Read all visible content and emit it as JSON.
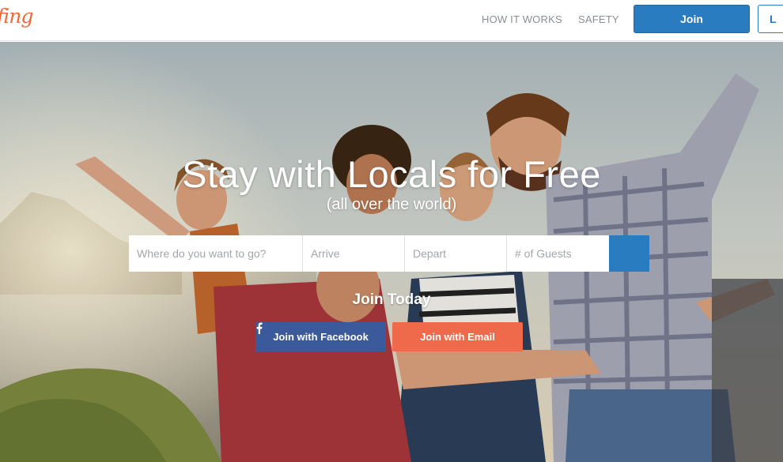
{
  "header": {
    "logo_text": "fing",
    "nav": {
      "how_it_works": "HOW IT WORKS",
      "safety": "SAFETY"
    },
    "join_label": "Join",
    "login_label": "L"
  },
  "hero": {
    "headline": "Stay with Locals for Free",
    "subheadline": "(all over the world)",
    "search": {
      "destination_placeholder": "Where do you want to go?",
      "arrive_placeholder": "Arrive",
      "depart_placeholder": "Depart",
      "guests_placeholder": "# of Guests",
      "search_icon": "search-icon"
    },
    "join_today": "Join Today",
    "facebook_label": "Join with Facebook",
    "email_label": "Join with Email"
  },
  "colors": {
    "brand_orange": "#ee6a3c",
    "primary_blue": "#2a7cc0",
    "facebook_blue": "#3a5a9b",
    "email_orange": "#ee6a4a"
  }
}
